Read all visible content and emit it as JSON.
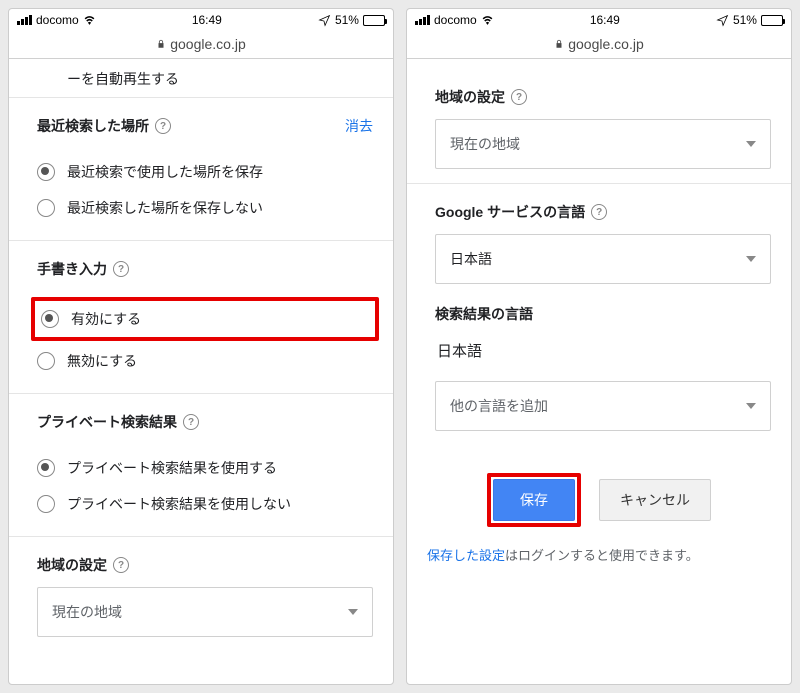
{
  "status": {
    "carrier": "docomo",
    "time": "16:49",
    "battery_pct": "51%"
  },
  "url": "google.co.jp",
  "left": {
    "fragment_top": "ーを自動再生する",
    "recently_searched": {
      "title": "最近検索した場所",
      "clear": "消去",
      "opt_save": "最近検索で使用した場所を保存",
      "opt_nosave": "最近検索した場所を保存しない"
    },
    "handwriting": {
      "title": "手書き入力",
      "enable": "有効にする",
      "disable": "無効にする"
    },
    "private_results": {
      "title": "プライベート検索結果",
      "use": "プライベート検索結果を使用する",
      "nouse": "プライベート検索結果を使用しない"
    },
    "region": {
      "title": "地域の設定",
      "current": "現在の地域"
    }
  },
  "right": {
    "region": {
      "title": "地域の設定",
      "current": "現在の地域"
    },
    "service_lang": {
      "title": "Google サービスの言語",
      "value": "日本語"
    },
    "result_lang": {
      "title": "検索結果の言語",
      "value": "日本語",
      "add": "他の言語を追加"
    },
    "buttons": {
      "save": "保存",
      "cancel": "キャンセル"
    },
    "footnote_link": "保存した設定",
    "footnote_rest": "はログインすると使用できます。"
  }
}
